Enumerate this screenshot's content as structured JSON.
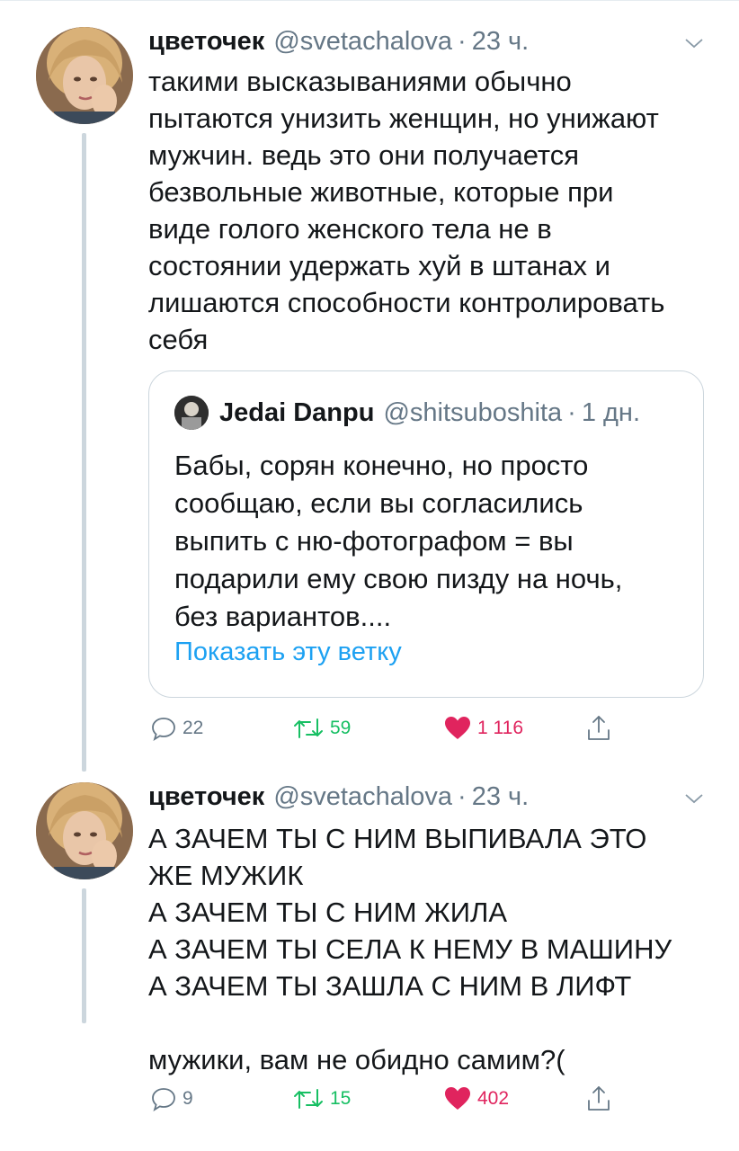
{
  "tweets": [
    {
      "author": {
        "name": "цветочек",
        "handle": "@svetachalova",
        "time": "23 ч."
      },
      "text": "такими высказываниями обычно\nпытаются унизить женщин, но унижают\nмужчин. ведь это они получается\nбезвольные животные, которые при\nвиде голого женского тела не в\nсостоянии удержать хуй в штанах и\nлишаются способности контролировать\nсебя",
      "quote": {
        "author": {
          "name": "Jedai Danpu",
          "handle": "@shitsuboshita",
          "time": "1 дн."
        },
        "text": "Бабы, сорян конечно, но просто\nсообщаю, если вы согласились\nвыпить с ню-фотографом = вы\nподарили ему свою пизду на ночь,\nбез вариантов....",
        "show_thread": "Показать эту ветку"
      },
      "actions": {
        "replies": "22",
        "retweets": "59",
        "likes": "1 116"
      }
    },
    {
      "author": {
        "name": "цветочек",
        "handle": "@svetachalova",
        "time": "23 ч."
      },
      "text": "А ЗАЧЕМ ТЫ С НИМ ВЫПИВАЛА ЭТО\nЖЕ МУЖИК\nА ЗАЧЕМ ТЫ С НИМ ЖИЛА\nА ЗАЧЕМ ТЫ СЕЛА К НЕМУ В МАШИНУ\nА ЗАЧЕМ ТЫ ЗАШЛА С НИМ В ЛИФТ\n\nмужики, вам не обидно самим?(",
      "actions": {
        "replies": "9",
        "retweets": "15",
        "likes": "402"
      }
    }
  ],
  "separator": "·",
  "icons": {
    "reply": "reply-icon",
    "retweet": "retweet-icon",
    "like": "heart-icon",
    "share": "share-icon",
    "menu": "chevron-down-icon"
  },
  "colors": {
    "text": "#14171a",
    "secondary": "#657786",
    "link": "#1da1f2",
    "retweet": "#17bf63",
    "like": "#e0245e",
    "border": "#ccd6dd"
  }
}
